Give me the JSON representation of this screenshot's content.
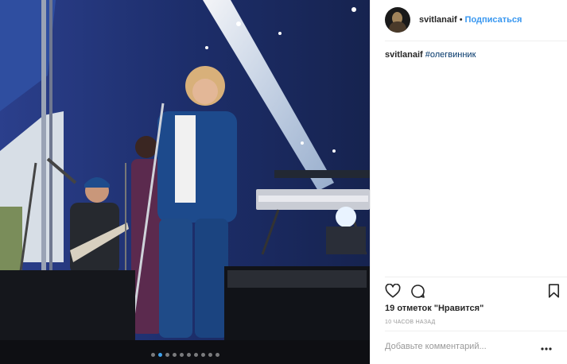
{
  "header": {
    "username": "svitlanaif",
    "separator": "•",
    "follow_label": "Подписаться",
    "avatar_icon": "profile-avatar"
  },
  "caption": {
    "username": "svitlanaif",
    "hashtag": "#олегвинник"
  },
  "photo": {
    "description_icon": "concert-photo",
    "carousel": {
      "total": 10,
      "active_index": 1
    }
  },
  "actions": {
    "like_icon": "heart-icon",
    "comment_icon": "speech-bubble-icon",
    "save_icon": "bookmark-icon"
  },
  "likes": {
    "count": "19",
    "text": "отметок \"Нравится\""
  },
  "timestamp": "10 ЧАСОВ НАЗАД",
  "comment": {
    "placeholder": "Добавьте комментарий...",
    "more_icon": "ellipsis-icon",
    "more_label": "..."
  },
  "colors": {
    "follow": "#3897f0",
    "hashtag": "#003569",
    "active_dot": "#3ea1ec",
    "muted": "#999999"
  }
}
